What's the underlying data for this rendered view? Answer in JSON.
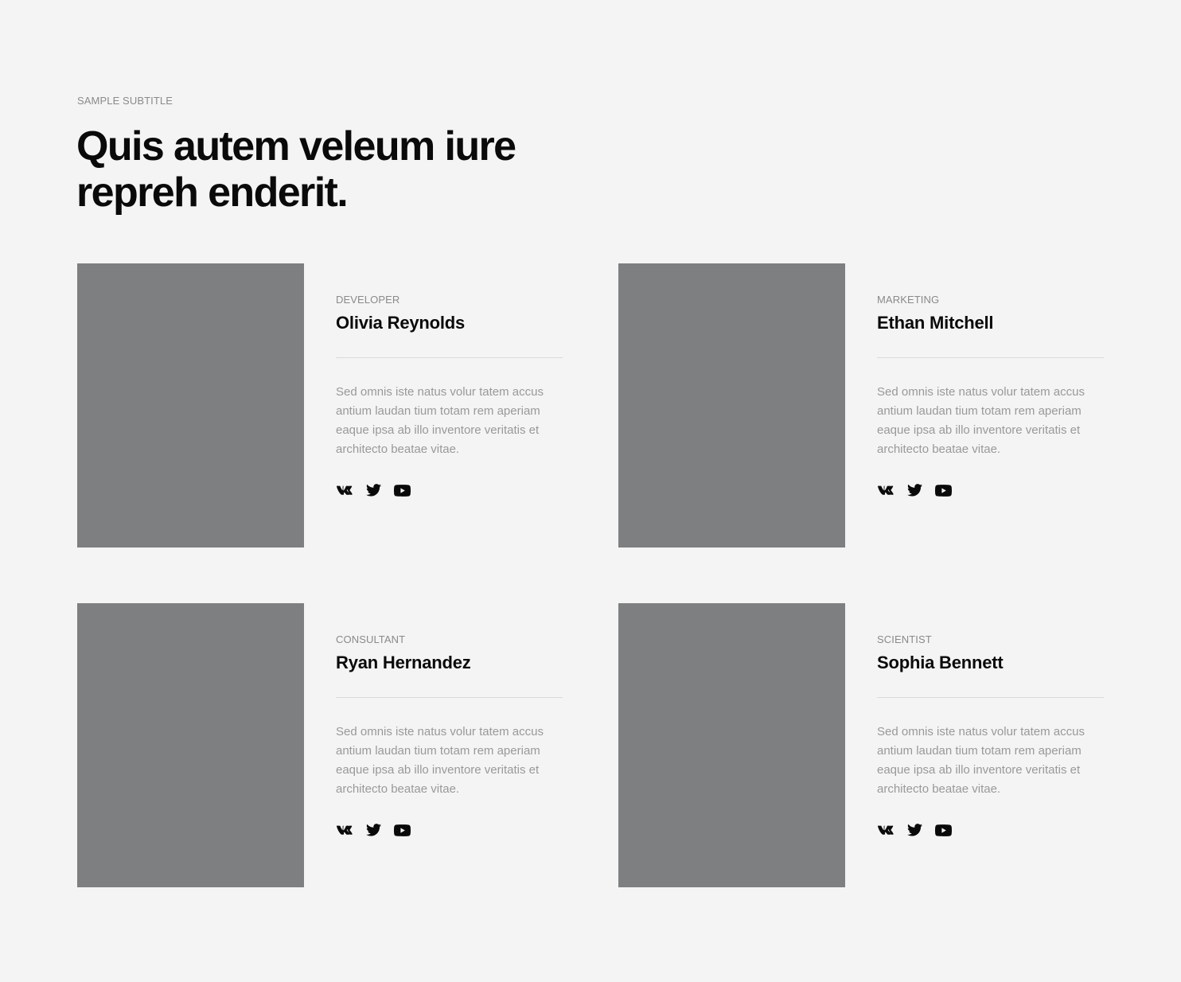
{
  "header": {
    "subtitle": "SAMPLE SUBTITLE",
    "title": "Quis autem veleum iure repreh enderit."
  },
  "colors": {
    "background": "#f4f4f4",
    "photo_placeholder": "#7e7f80",
    "text_primary": "#0a0a0a",
    "text_muted": "#999999"
  },
  "team": [
    {
      "role": "DEVELOPER",
      "name": "Olivia Reynolds",
      "bio": "Sed omnis iste natus volur tatem accus antium laudan tium totam rem aperiam eaque ipsa ab illo inventore veritatis et architecto beatae vitae.",
      "socials": [
        "vk-icon",
        "twitter-icon",
        "youtube-icon"
      ]
    },
    {
      "role": "MARKETING",
      "name": "Ethan Mitchell",
      "bio": "Sed omnis iste natus volur tatem accus antium laudan tium totam rem aperiam eaque ipsa ab illo inventore veritatis et architecto beatae vitae.",
      "socials": [
        "vk-icon",
        "twitter-icon",
        "youtube-icon"
      ]
    },
    {
      "role": "CONSULTANT",
      "name": "Ryan Hernandez",
      "bio": "Sed omnis iste natus volur tatem accus antium laudan tium totam rem aperiam eaque ipsa ab illo inventore veritatis et architecto beatae vitae.",
      "socials": [
        "vk-icon",
        "twitter-icon",
        "youtube-icon"
      ]
    },
    {
      "role": "SCIENTIST",
      "name": "Sophia Bennett",
      "bio": "Sed omnis iste natus volur tatem accus antium laudan tium totam rem aperiam eaque ipsa ab illo inventore veritatis et architecto beatae vitae.",
      "socials": [
        "vk-icon",
        "twitter-icon",
        "youtube-icon"
      ]
    }
  ]
}
